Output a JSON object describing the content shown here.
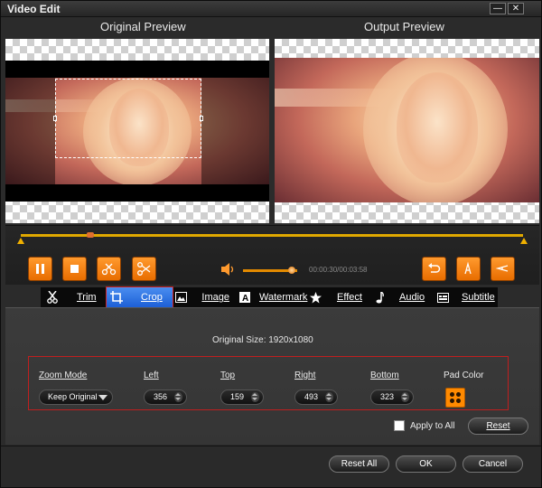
{
  "window": {
    "title": "Video Edit",
    "minimize_symbol": "—",
    "close_symbol": "✕"
  },
  "preview": {
    "original_label": "Original Preview",
    "output_label": "Output Preview"
  },
  "playback": {
    "timecode": "00:00:30/00:03:58",
    "volume_level": 0.9
  },
  "tabs": [
    {
      "label": "Trim",
      "icon": "scissors-icon"
    },
    {
      "label": "Crop",
      "icon": "crop-icon",
      "active": true
    },
    {
      "label": "Image",
      "icon": "image-icon"
    },
    {
      "label": "Watermark",
      "icon": "watermark-icon"
    },
    {
      "label": "Effect",
      "icon": "star-icon"
    },
    {
      "label": "Audio",
      "icon": "music-note-icon"
    },
    {
      "label": "Subtitle",
      "icon": "subtitle-icon"
    }
  ],
  "crop": {
    "original_size": "Original Size: 1920x1080",
    "zoom_mode_label": "Zoom Mode",
    "zoom_mode_value": "Keep Original",
    "left_label": "Left",
    "left_value": "356",
    "top_label": "Top",
    "top_value": "159",
    "right_label": "Right",
    "right_value": "493",
    "bottom_label": "Bottom",
    "bottom_value": "323",
    "pad_color_label": "Pad Color",
    "pad_color": "#ff8a00",
    "apply_all_label": "Apply to All",
    "reset_label": "Reset"
  },
  "footer": {
    "reset_all_label": "Reset All",
    "ok_label": "OK",
    "cancel_label": "Cancel"
  },
  "colors": {
    "accent": "#ff8a00",
    "tab_active": "#2a6fe0",
    "highlight_outline": "#d02020"
  }
}
